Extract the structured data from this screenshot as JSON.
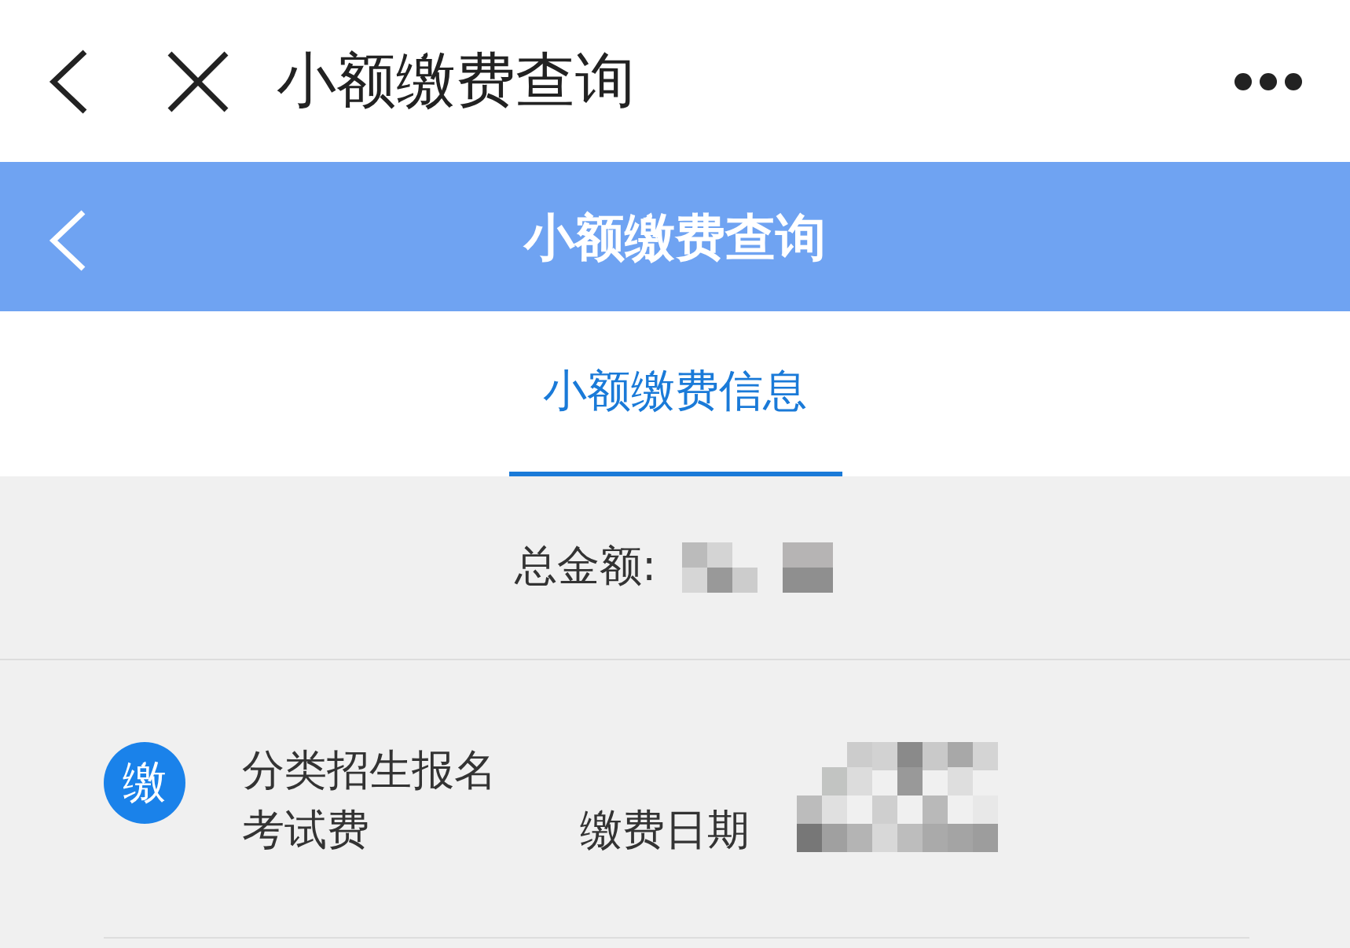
{
  "top_bar": {
    "title": "小额缴费查询"
  },
  "header": {
    "title": "小额缴费查询"
  },
  "tabs": [
    {
      "label": "小额缴费信息",
      "selected": true
    }
  ],
  "total": {
    "label": "总金额:"
  },
  "payments": [
    {
      "badge": "缴",
      "name": "分类招生报名考试费",
      "date_label": "缴费日期"
    }
  ]
}
